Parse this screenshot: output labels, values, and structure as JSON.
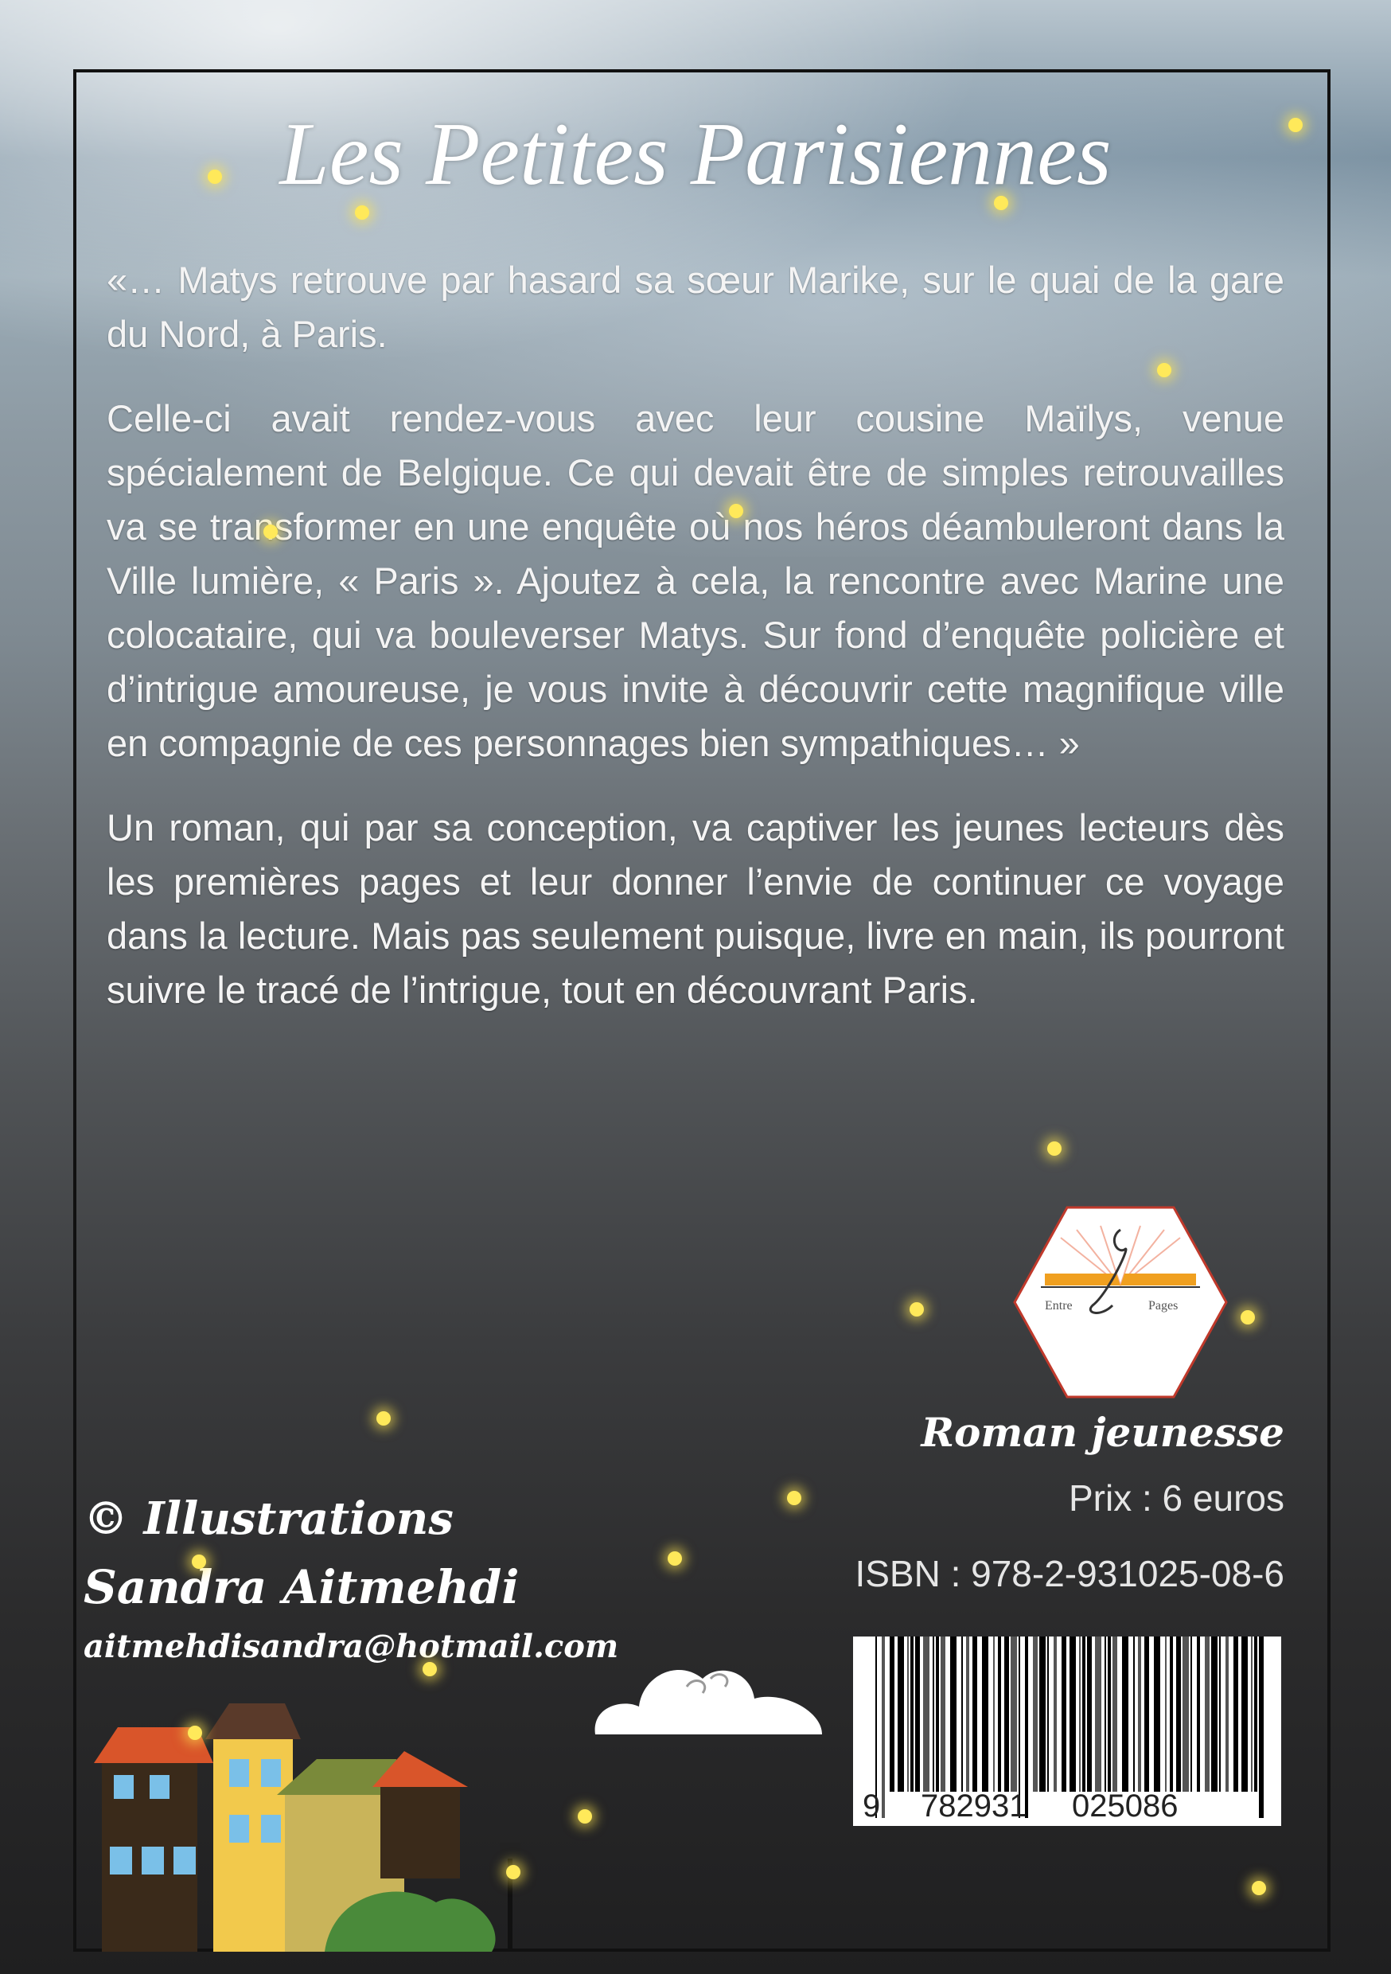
{
  "title": "Les Petites Parisiennes",
  "paragraphs": [
    "«… Matys retrouve par hasard sa sœur Marike, sur le quai de la gare du Nord, à Paris.",
    "Celle-ci avait rendez-vous avec leur cousine Maïlys, venue spécialement de Belgique. Ce qui devait être de simples retrouvailles va se transformer en une enquête où nos héros déambuleront dans la Ville lumière, « Paris ». Ajoutez à cela, la rencontre avec Marine une colocataire, qui va bouleverser Matys. Sur fond d’enquête policière et d’intrigue amoureuse, je vous invite à découvrir cette magnifique ville en compagnie de ces personnages bien sympathiques… »",
    "Un roman, qui par sa conception, va captiver les jeunes lecteurs dès les premières pages et leur donner l’envie de continuer ce voyage dans la lecture. Mais pas seulement puisque, livre en main, ils pourront suivre le tracé de l’intrigue, tout en découvrant Paris."
  ],
  "publisher": {
    "logo_left": "Entre",
    "logo_right": "Pages"
  },
  "genre": "Roman jeunesse",
  "price": "Prix : 6 euros",
  "isbn": "ISBN : 978-2-931025-08-6",
  "barcode": {
    "d1": "9",
    "d2": "782931",
    "d3": "025086"
  },
  "credits": {
    "line1": "© Illustrations",
    "line2": "Sandra Aitmehdi",
    "email": "aitmehdisandra@hotmail.com"
  },
  "colors": {
    "firefly": "#ffe95a",
    "logo_border": "#c0392b",
    "book": "#f0a020"
  }
}
